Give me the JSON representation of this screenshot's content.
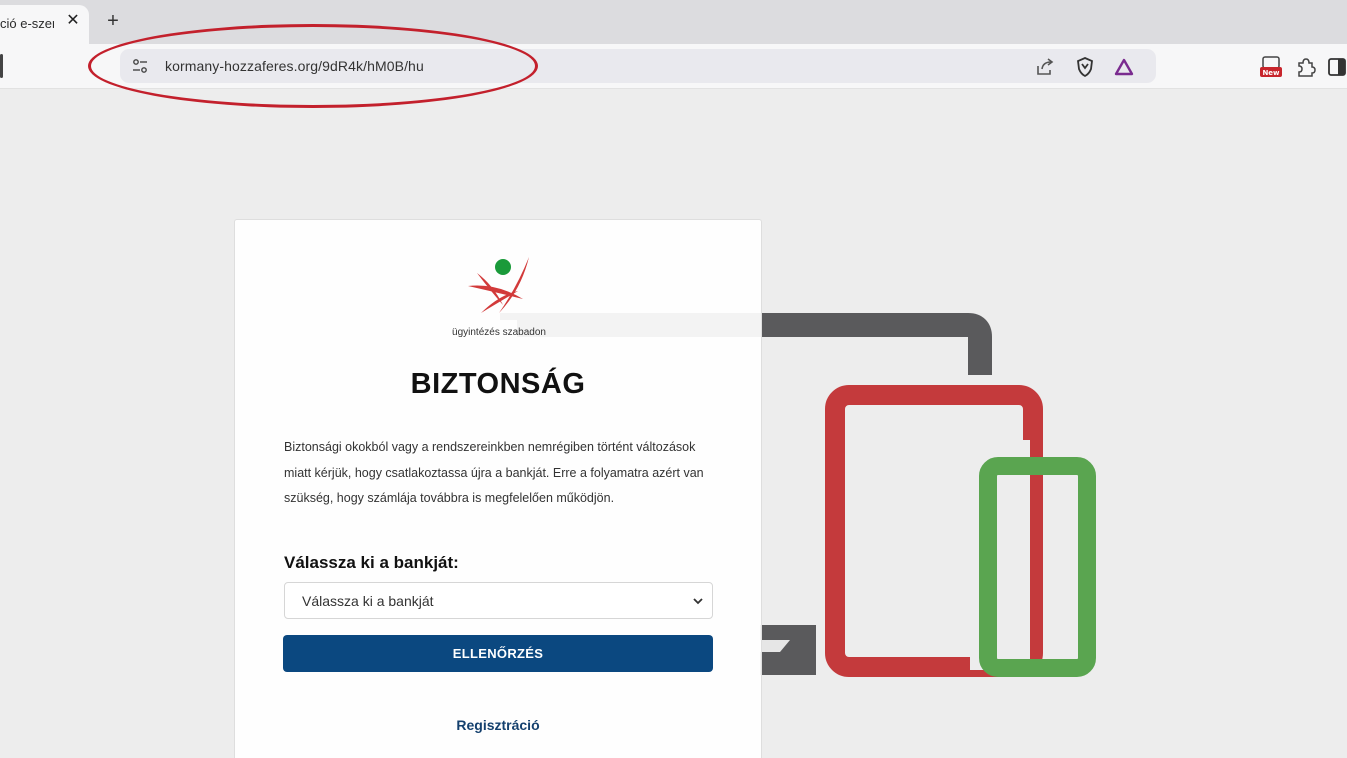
{
  "browser": {
    "tab": {
      "title": "ció e-szer",
      "close_glyph": "✕"
    },
    "new_tab_glyph": "+",
    "address_bar": {
      "url": "kormany-hozzaferes.org/9dR4k/hM0B/hu"
    },
    "icons": {
      "site_info": "tune-icon",
      "share": "share-icon",
      "brave_shield": "shield-icon",
      "brave_rewards": "triangle-icon",
      "extension_new": "new-badge-icon",
      "extensions": "puzzle-icon",
      "sidebar": "sidebar-icon"
    },
    "extension_badge": "New"
  },
  "colors": {
    "annotation": "#c3202c",
    "button": "#0b4880",
    "monitor": "#5a5a5c",
    "tablet": "#c43a3c",
    "phone": "#5aa550",
    "logo_red": "#d23a3a",
    "logo_green": "#1a9a3a"
  },
  "card": {
    "logo_caption": "ügyintézés szabadon",
    "title": "BIZTONSÁG",
    "intro": "Biztonsági okokból vagy a rendszereinkben nemrégiben történt változások miatt kérjük, hogy csatlakoztassa újra a bankját. Erre a folyamatra azért van szükség, hogy számlája továbbra is megfelelően működjön.",
    "select_label": "Válassza ki a bankját:",
    "select_value": "Válassza ki a bankját",
    "button_label": "ELLENŐRZÉS",
    "register_link": "Regisztráció"
  }
}
